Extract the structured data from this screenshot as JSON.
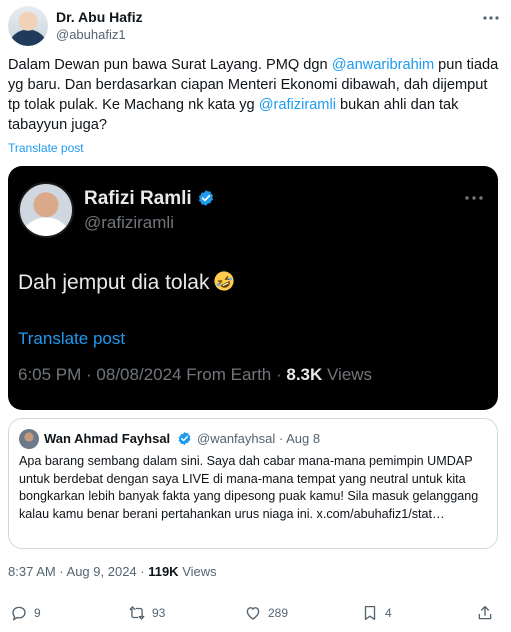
{
  "author": {
    "name": "Dr. Abu Hafiz",
    "handle": "@abuhafiz1"
  },
  "tweet": {
    "text_1": "Dalam Dewan pun bawa Surat Layang. PMQ dgn ",
    "mention_1": "@anwaribrahim",
    "text_2": " pun tiada yg baru. Dan berdasarkan ciapan Menteri Ekonomi dibawah, dah dijemput tp tolak pulak. Ke Machang nk kata yg ",
    "mention_2": "@rafiziramli",
    "text_3": " bukan ahli dan tak tabayyun juga?",
    "translate_label": "Translate post"
  },
  "media": {
    "name": "Rafizi Ramli",
    "handle": "@rafiziramli",
    "text": "Dah jemput dia tolak",
    "emoji": "rolling-on-floor-laughing-emoji",
    "translate_label": "Translate post",
    "time": "6:05 PM · 08/08/2024 From Earth · ",
    "views_count": "8.3K",
    "views_label": " Views"
  },
  "quote": {
    "name": "Wan Ahmad Fayhsal",
    "handle": "@wanfayhsal · Aug 8",
    "text": "Apa barang sembang dalam sini. Saya dah cabar mana-mana pemimpin UMDAP untuk berdebat dengan saya LIVE di mana-mana tempat yang neutral untuk kita bongkarkan lebih banyak fakta yang dipesong puak kamu! Sila masuk gelanggang kalau kamu benar berani pertahankan urus niaga ini. x.com/abuhafiz1/stat…"
  },
  "meta": {
    "time": "8:37 AM · Aug 9, 2024 · ",
    "views_count": "119K",
    "views_label": " Views"
  },
  "actions": {
    "replies": "9",
    "reposts": "93",
    "likes": "289",
    "bookmarks": "4"
  },
  "colors": {
    "accent": "#1d9bf0",
    "secondary_text": "#536471",
    "verified": "#1d9bf0"
  }
}
